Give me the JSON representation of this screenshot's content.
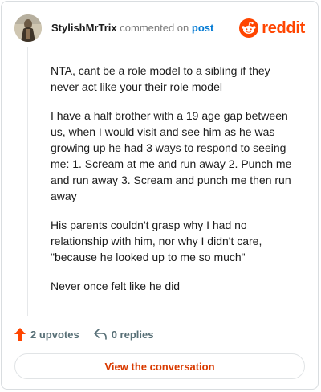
{
  "header": {
    "username": "StylishMrTrix",
    "action_text": "commented on",
    "post_link": "post",
    "logo_text": "reddit"
  },
  "comment": {
    "paragraphs": [
      "NTA, cant be a role model to a sibling if they never act like your their role model",
      "I have a half brother with a 19 age gap between us, when I would visit and see him as he was growing up he had 3 ways to respond to seeing me: 1. Scream at me and run away 2. Punch me and run away 3. Scream and punch me then run away",
      "His parents couldn't grasp why I had no relationship with him, nor why I didn't care, \"because he looked up to me so much\"",
      "Never once felt like he did"
    ]
  },
  "footer": {
    "upvotes": "2 upvotes",
    "replies": "0 replies",
    "cta": "View the conversation"
  },
  "colors": {
    "brand": "#ff4500",
    "link": "#0079d3",
    "cta": "#d93a00"
  }
}
